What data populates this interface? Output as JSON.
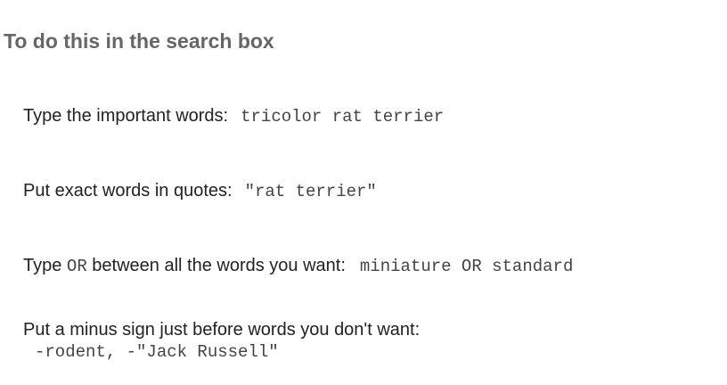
{
  "heading": "To do this in the search box",
  "tips": [
    {
      "label": "Type the important words:",
      "example": "tricolor rat terrier"
    },
    {
      "label": "Put exact words in quotes:",
      "example": "\"rat terrier\""
    },
    {
      "label_before": "Type",
      "operator": "OR",
      "label_after": "between all the words you want:",
      "example": "miniature OR standard"
    },
    {
      "label": "Put a minus sign just before words you don't want:",
      "example": "-rodent, -\"Jack Russell\""
    }
  ]
}
